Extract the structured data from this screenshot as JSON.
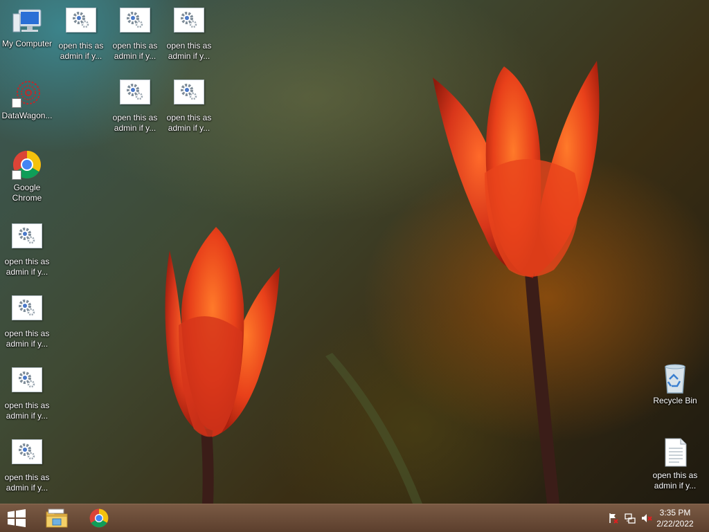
{
  "desktop": {
    "icons_left": [
      {
        "label": "My Computer",
        "icon": "computer-icon"
      },
      {
        "label": "DataWagon...",
        "icon": "datawagon-icon"
      },
      {
        "label": "Google Chrome",
        "icon": "chrome-icon"
      },
      {
        "label": "open this as admin if y...",
        "icon": "settings-file-icon"
      },
      {
        "label": "open this as admin if y...",
        "icon": "settings-file-icon"
      },
      {
        "label": "open this as admin if y...",
        "icon": "settings-file-icon"
      },
      {
        "label": "open this as admin if y...",
        "icon": "settings-file-icon"
      }
    ],
    "icons_top": [
      {
        "label": "open this as admin if y...",
        "icon": "settings-file-icon"
      },
      {
        "label": "open this as admin if y...",
        "icon": "settings-file-icon"
      },
      {
        "label": "open this as admin if y...",
        "icon": "settings-file-icon"
      },
      {
        "label": "open this as admin if y...",
        "icon": "settings-file-icon"
      },
      {
        "label": "open this as admin if y...",
        "icon": "settings-file-icon"
      }
    ],
    "icons_right": [
      {
        "label": "Recycle Bin",
        "icon": "recycle-bin-icon"
      },
      {
        "label": "open this as admin if y...",
        "icon": "text-file-icon"
      }
    ]
  },
  "taskbar": {
    "pinned": [
      {
        "name": "start-button",
        "icon": "windows-logo-icon"
      },
      {
        "name": "file-explorer-button",
        "icon": "folder-icon"
      },
      {
        "name": "chrome-taskbar-button",
        "icon": "chrome-icon"
      }
    ],
    "tray_icons": [
      "action-center-flag-icon",
      "network-icon",
      "volume-muted-icon"
    ],
    "clock": {
      "time": "3:35 PM",
      "date": "2/22/2022"
    }
  },
  "colors": {
    "taskbar": "#6b4a36",
    "tulip": "#e8401a",
    "chrome_red": "#db4437",
    "chrome_yellow": "#f4c20d",
    "chrome_green": "#0f9d58",
    "chrome_blue": "#4285f4"
  }
}
